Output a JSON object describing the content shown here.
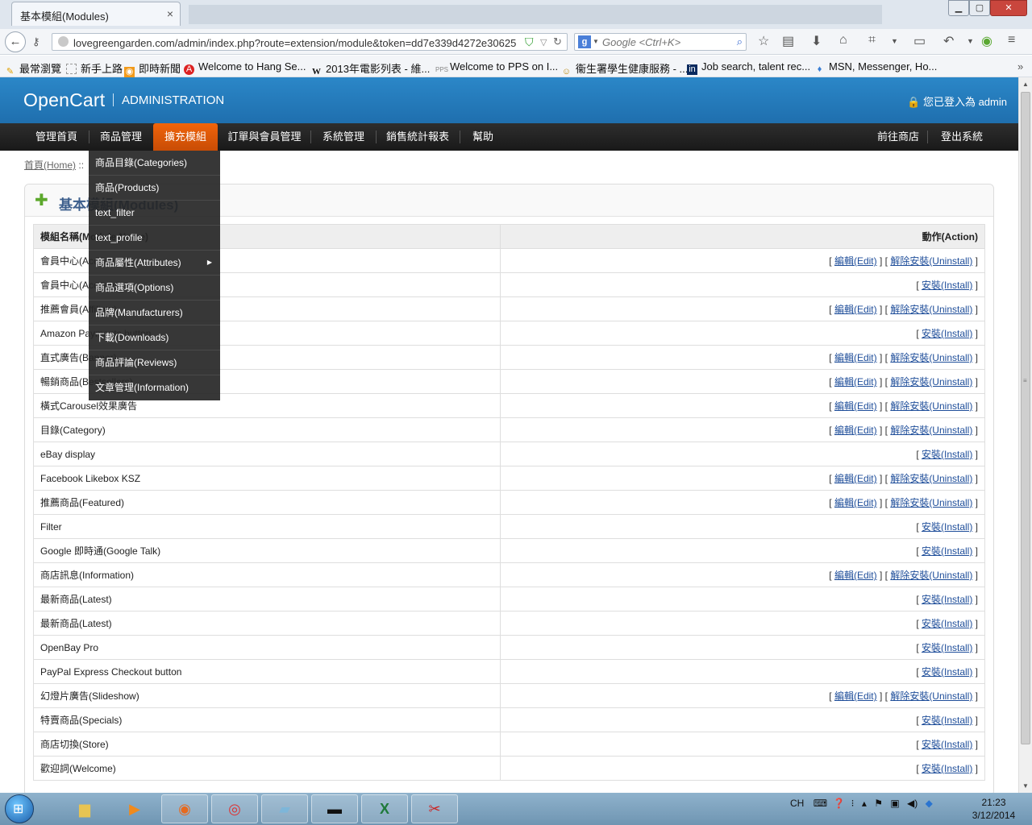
{
  "browser": {
    "tab_title": "基本模組(Modules)",
    "tab_close": "×",
    "url": "lovegreengarden.com/admin/index.php?route=extension/module&token=dd7e339d4272e30625",
    "search_placeholder": "Google <Ctrl+K>",
    "bookmarks": [
      "最常瀏覽",
      "新手上路",
      "即時新聞",
      "Welcome to Hang Se...",
      "2013年電影列表 - 維...",
      "Welcome to PPS on I...",
      "衞生署學生健康服務 - ...",
      "Job search, talent rec...",
      "MSN, Messenger, Ho..."
    ]
  },
  "header": {
    "logo": "OpenCart",
    "subtitle": "ADMINISTRATION",
    "user_status": "您已登入為 admin"
  },
  "menu": {
    "items": [
      "管理首頁",
      "商品管理",
      "擴充模組",
      "訂單與會員管理",
      "系統管理",
      "銷售統計報表",
      "幫助"
    ],
    "right_items": [
      "前往商店",
      "登出系統"
    ]
  },
  "dropdown": {
    "items": [
      "商品目錄(Categories)",
      "商品(Products)",
      "text_filter",
      "text_profile",
      "商品屬性(Attributes)",
      "商品選項(Options)",
      "品牌(Manufacturers)",
      "下載(Downloads)",
      "商品評論(Reviews)",
      "文章管理(Information)"
    ]
  },
  "breadcrumb": {
    "home": "首頁(Home)",
    "separator": "::"
  },
  "page": {
    "title": "基本模組(Modules)"
  },
  "table": {
    "col_name": "模組名稱(Module Name)",
    "col_action": "動作(Action)",
    "edit_label": "編輯(Edit)",
    "uninstall_label": "解除安裝(Uninstall)",
    "install_label": "安裝(Install)",
    "rows": [
      {
        "name": "會員中心(Account)",
        "installed": true
      },
      {
        "name": "會員中心(Account)",
        "installed": false
      },
      {
        "name": "推薦會員(Affiliate)",
        "installed": true
      },
      {
        "name": "Amazon Payments button",
        "installed": false
      },
      {
        "name": "直式廣告(Banner)",
        "installed": true
      },
      {
        "name": "暢銷商品(Bestsellers)",
        "installed": true
      },
      {
        "name": "橫式Carousel效果廣告",
        "installed": true
      },
      {
        "name": "目錄(Category)",
        "installed": true
      },
      {
        "name": "eBay display",
        "installed": false
      },
      {
        "name": "Facebook Likebox KSZ",
        "installed": true
      },
      {
        "name": "推薦商品(Featured)",
        "installed": true
      },
      {
        "name": "Filter",
        "installed": false
      },
      {
        "name": "Google 即時通(Google Talk)",
        "installed": false
      },
      {
        "name": "商店訊息(Information)",
        "installed": true
      },
      {
        "name": "最新商品(Latest)",
        "installed": false
      },
      {
        "name": "最新商品(Latest)",
        "installed": false
      },
      {
        "name": "OpenBay Pro",
        "installed": false
      },
      {
        "name": "PayPal Express Checkout button",
        "installed": false
      },
      {
        "name": "幻燈片廣告(Slideshow)",
        "installed": true
      },
      {
        "name": "特賣商品(Specials)",
        "installed": false
      },
      {
        "name": "商店切換(Store)",
        "installed": false
      },
      {
        "name": "歡迎詞(Welcome)",
        "installed": false
      }
    ]
  },
  "taskbar": {
    "lang": "CH",
    "time": "21:23",
    "date": "3/12/2014"
  }
}
